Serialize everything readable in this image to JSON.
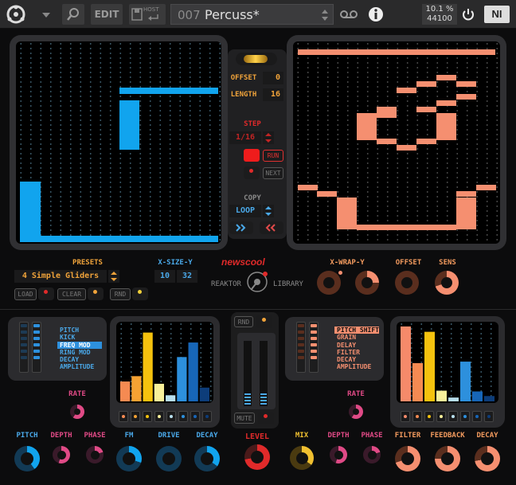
{
  "topbar": {
    "edit_label": "EDIT",
    "host_label": "HOST",
    "preset_number": "007",
    "preset_name": "Percuss*",
    "cpu": "10.1 %",
    "sample_rate": "44100",
    "ni_label": "NI"
  },
  "step_controls": {
    "offset_label": "OFFSET",
    "offset_value": "0",
    "length_label": "LENGTH",
    "length_value": "16",
    "step_label": "STEP",
    "step_value": "1/16",
    "run_label": "RUN",
    "next_label": "NEXT",
    "copy_label": "COPY",
    "loop_value": "LOOP"
  },
  "presets": {
    "label": "PRESETS",
    "selected": "4 Simple Gliders",
    "load_label": "LOAD",
    "clear_label": "CLEAR",
    "rnd_label": "RND"
  },
  "size": {
    "label": "X-SIZE-Y",
    "x": "10",
    "y": "32"
  },
  "logo": {
    "brand_a": "new",
    "brand_b": "scool",
    "reaktor": "REAKTOR",
    "library": "LIBRARY"
  },
  "wrap": {
    "label": "X-WRAP-Y",
    "offset_label": "OFFSET",
    "sens_label": "SENS"
  },
  "left_synth": {
    "rnd_label": "RND",
    "targets": [
      "PITCH",
      "KICK",
      "FREQ MOD",
      "RING MOD",
      "DECAY",
      "AMPLITUDE"
    ],
    "selected_target": "FREQ MOD",
    "rate_label": "RATE",
    "knob_labels": [
      "PITCH",
      "DEPTH",
      "PHASE",
      "FM",
      "DRIVE",
      "DECAY"
    ],
    "bars": [
      0.26,
      0.33,
      0.9,
      0.23,
      0.08,
      0.58,
      0.77,
      0.18
    ],
    "bar_colors": [
      "#f58a52",
      "#f5a233",
      "#f5c20e",
      "#f8f09a",
      "#b8dfee",
      "#2d90dd",
      "#1766b8",
      "#0d3d7a"
    ]
  },
  "center": {
    "mute_label": "MUTE",
    "level_label": "LEVEL"
  },
  "right_synth": {
    "targets": [
      "PITCH SHIFT",
      "GRAIN",
      "DELAY",
      "FILTER",
      "DECAY",
      "AMPLITUDE"
    ],
    "selected_target": "PITCH SHIFT",
    "rate_label": "RATE",
    "knob_labels": [
      "MIX",
      "DEPTH",
      "PHASE",
      "FILTER",
      "FEEDBACK",
      "DECAY"
    ],
    "bars": [
      0.98,
      0.5,
      0.91,
      0.14,
      0.05,
      0.52,
      0.13,
      0.07
    ],
    "bar_colors": [
      "#f58a6a",
      "#f58a52",
      "#f5c20e",
      "#f8f09a",
      "#b8dfee",
      "#2d90dd",
      "#1766b8",
      "#0d3d7a"
    ]
  },
  "colors": {
    "orange": "#f0a33a",
    "blue": "#11a4ee",
    "salmon": "#f58f70",
    "red": "#e02a2a",
    "pink": "#e04a86"
  }
}
